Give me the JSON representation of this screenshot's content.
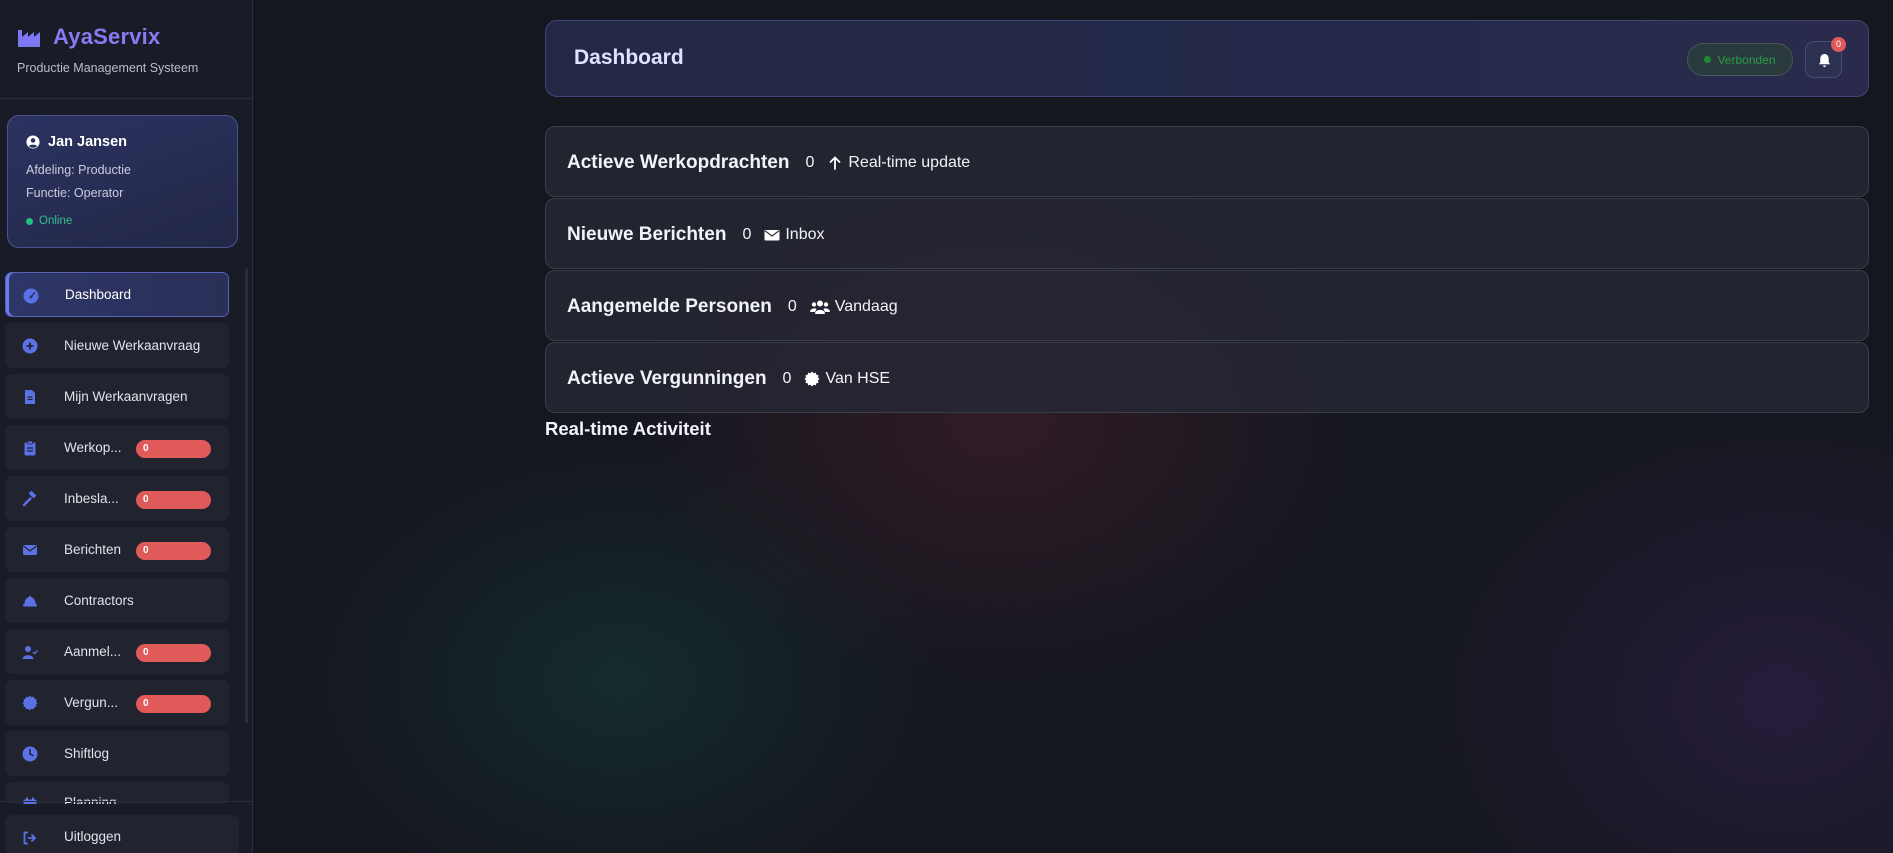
{
  "brand": {
    "name": "AyaServix",
    "subtitle": "Productie Management Systeem"
  },
  "user": {
    "name": "Jan Jansen",
    "department": "Afdeling: Productie",
    "role": "Functie: Operator",
    "status": "Online"
  },
  "nav": {
    "items": [
      {
        "label": "Dashboard",
        "icon": "gauge-icon",
        "active": true
      },
      {
        "label": "Nieuwe Werkaanvraag",
        "icon": "plus-circle-icon"
      },
      {
        "label": "Mijn Werkaanvragen",
        "icon": "file-icon"
      },
      {
        "label": "Werkop...",
        "icon": "clipboard-icon",
        "badge": "0"
      },
      {
        "label": "Inbesla...",
        "icon": "hammer-icon",
        "badge": "0"
      },
      {
        "label": "Berichten",
        "icon": "envelope-icon",
        "badge": "0"
      },
      {
        "label": "Contractors",
        "icon": "hardhat-icon"
      },
      {
        "label": "Aanmel...",
        "icon": "user-check-icon",
        "badge": "0"
      },
      {
        "label": "Vergun...",
        "icon": "certificate-icon",
        "badge": "0"
      },
      {
        "label": "Shiftlog",
        "icon": "clock-icon"
      },
      {
        "label": "Planning",
        "icon": "calendar-icon"
      }
    ],
    "logout": "Uitloggen"
  },
  "header": {
    "title": "Dashboard",
    "connection_status": "Verbonden",
    "notification_count": "0"
  },
  "cards": [
    {
      "title": "Actieve Werkopdrachten",
      "count": "0",
      "meta": "Real-time update",
      "icon": "arrow-up-icon"
    },
    {
      "title": "Nieuwe Berichten",
      "count": "0",
      "meta": "Inbox",
      "icon": "envelope-icon"
    },
    {
      "title": "Aangemelde Personen",
      "count": "0",
      "meta": "Vandaag",
      "icon": "users-icon"
    },
    {
      "title": "Actieve Vergunningen",
      "count": "0",
      "meta": "Van HSE",
      "icon": "certificate-icon"
    }
  ],
  "activity": {
    "title": "Real-time Activiteit"
  },
  "colors": {
    "accent": "#8b79f2",
    "nav_icon": "#5b72e6",
    "badge": "#e05a5a",
    "online": "#1fbf7c"
  }
}
